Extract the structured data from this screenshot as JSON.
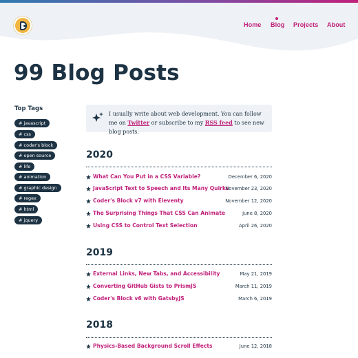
{
  "colors": {
    "accent": "#c0207a",
    "dark": "#1d3344",
    "header_bg": "#eef1f5",
    "logo": "#f3b541",
    "gradient_start": "#2f7bb0",
    "gradient_end": "#c0207a"
  },
  "header": {
    "logo_icon": "bookmark-logo-icon",
    "nav": [
      {
        "label": "Home"
      },
      {
        "label": "Blog",
        "active": true
      },
      {
        "label": "Projects"
      },
      {
        "label": "About"
      }
    ]
  },
  "page": {
    "title": "99 Blog Posts"
  },
  "sidebar": {
    "heading": "Top Tags",
    "tags": [
      "# javascript",
      "# css",
      "# coder's block",
      "# open source",
      "# life",
      "# animation",
      "# graphic design",
      "# regex",
      "# html",
      "# jquery"
    ]
  },
  "intro": {
    "icon": "sparkles-icon",
    "text_before": "I usually write about web development. You can follow me on ",
    "twitter_label": "Twitter",
    "text_middle": " or subscribe to my ",
    "rss_label": "RSS feed",
    "text_after": " to see new blog posts."
  },
  "years": [
    {
      "year": "2020",
      "posts": [
        {
          "title": "What Can You Put in a CSS Variable?",
          "date": "December 6, 2020"
        },
        {
          "title": "JavaScript Text to Speech and Its Many Quirks",
          "date": "November 23, 2020"
        },
        {
          "title": "Coder's Block v7 with Eleventy",
          "date": "November 12, 2020"
        },
        {
          "title": "The Surprising Things That CSS Can Animate",
          "date": "June 8, 2020"
        },
        {
          "title": "Using CSS to Control Text Selection",
          "date": "April 26, 2020"
        }
      ]
    },
    {
      "year": "2019",
      "posts": [
        {
          "title": "External Links, New Tabs, and Accessibility",
          "date": "May 21, 2019"
        },
        {
          "title": "Converting GitHub Gists to PrismJS",
          "date": "March 11, 2019"
        },
        {
          "title": "Coder's Block v6 with GatsbyJS",
          "date": "March 6, 2019"
        }
      ]
    },
    {
      "year": "2018",
      "posts": [
        {
          "title": "Physics-Based Background Scroll Effects",
          "date": "June 12, 2018"
        }
      ]
    }
  ]
}
